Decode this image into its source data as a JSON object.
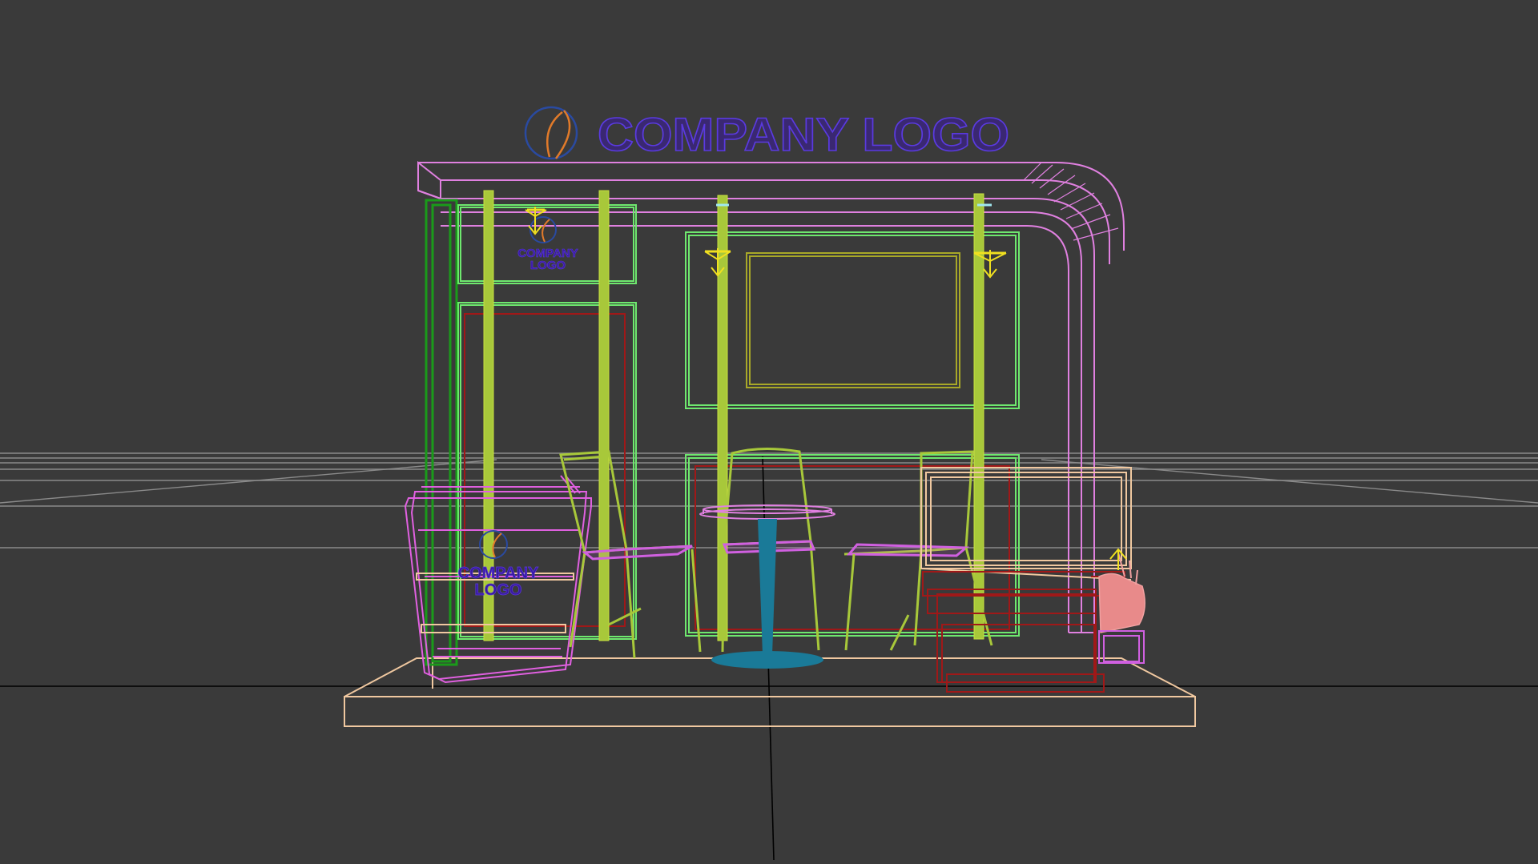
{
  "viewport": {
    "background": "#3a3a3a",
    "grid_color": "#7a7a7a",
    "axis_color": "#000000"
  },
  "colors": {
    "roof": "#e080e0",
    "floor": "#f0c8a0",
    "panel": "#6ee86e",
    "post": "#a8c83a",
    "dark_green": "#1a9a1a",
    "logo_text": "#3a1aa0",
    "logo_blue": "#2a4aa0",
    "logo_orange": "#e07a2a",
    "counter": "#e060e0",
    "table_top": "#e080e0",
    "table_stand": "#1a7a98",
    "chair": "#a8c83a",
    "chair_seat": "#d060e0",
    "red_box": "#a01818",
    "light": "#f0e020",
    "plant": "#e88a8a",
    "cabinet": "#f0c8a0",
    "tv": "#a8a828"
  },
  "signage": {
    "main_logo_text": "COMPANY LOGO",
    "wall_logo_line1": "COMPANY",
    "wall_logo_line2": "LOGO",
    "counter_logo_line1": "COMPANY",
    "counter_logo_line2": "LOGO"
  },
  "icons": {
    "logo_mark": "circle-swoosh-icon",
    "spot_light": "spot-light-icon"
  }
}
